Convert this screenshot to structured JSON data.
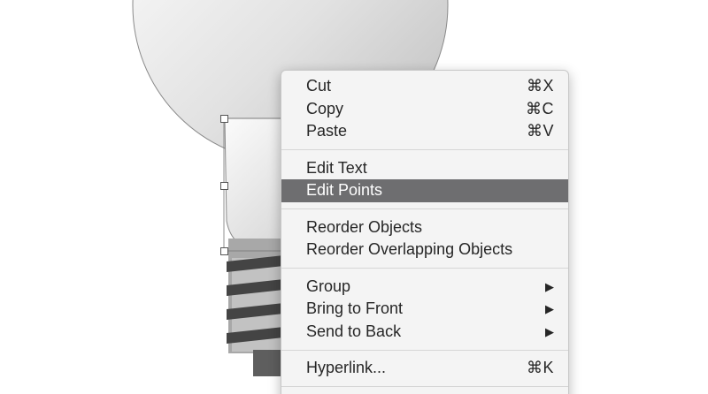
{
  "menu": {
    "groups": [
      {
        "items": [
          {
            "label": "Cut",
            "shortcut": "⌘X"
          },
          {
            "label": "Copy",
            "shortcut": "⌘C"
          },
          {
            "label": "Paste",
            "shortcut": "⌘V"
          }
        ]
      },
      {
        "items": [
          {
            "label": "Edit Text"
          },
          {
            "label": "Edit Points",
            "highlighted": true
          }
        ]
      },
      {
        "items": [
          {
            "label": "Reorder Objects"
          },
          {
            "label": "Reorder Overlapping Objects"
          }
        ]
      },
      {
        "items": [
          {
            "label": "Group",
            "submenu_icon": "triangle-right-icon",
            "submenu_glyph": "▶"
          },
          {
            "label": "Bring to Front",
            "submenu_icon": "triangle-right-icon",
            "submenu_glyph": "▶"
          },
          {
            "label": "Send to Back",
            "submenu_icon": "triangle-right-icon",
            "submenu_glyph": "▶"
          }
        ]
      },
      {
        "items": [
          {
            "label": "Hyperlink...",
            "shortcut": "⌘K"
          }
        ]
      }
    ],
    "highlight_color": "#6e6e70",
    "text_color": "#262626",
    "background_color": "#f4f4f4"
  },
  "canvas": {
    "object": "light-bulb-illustration",
    "selected_shape": "bulb-neck-shape"
  }
}
